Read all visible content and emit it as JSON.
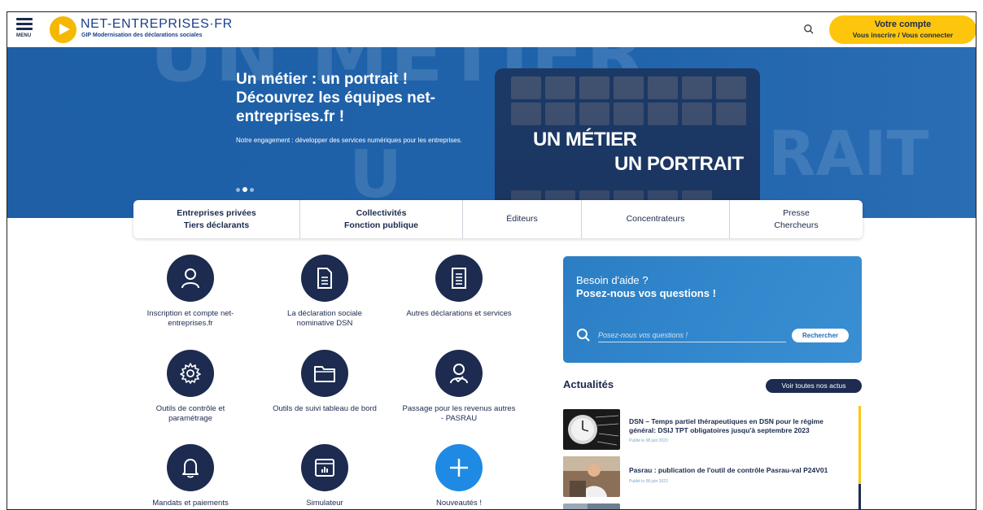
{
  "header": {
    "menu_label": "MENU",
    "logo_title": "NET-ENTREPRISES·FR",
    "logo_subtitle": "GIP Modernisation des déclarations sociales",
    "account_line1": "Votre compte",
    "account_line2": "Vous inscrire / Vous connecter"
  },
  "hero": {
    "bg_word_1": "UN MÉTIER",
    "bg_word_2": "RAIT",
    "bg_word_3": "U",
    "title": "Un métier : un portrait ! Découvrez les équipes net-entreprises.fr !",
    "text": "Notre engagement : développer des services numériques pour les entreprises.",
    "photo_line1": "UN MÉTIER",
    "photo_line2": "UN PORTRAIT",
    "slide_count": 3,
    "active_slide": 2
  },
  "tabs": [
    {
      "line1": "Entreprises privées",
      "line2": "Tiers déclarants"
    },
    {
      "line1": "Collectivités",
      "line2": "Fonction publique"
    },
    {
      "line1": "Éditeurs",
      "line2": ""
    },
    {
      "line1": "Concentrateurs",
      "line2": ""
    },
    {
      "line1": "Presse",
      "line2": "Chercheurs"
    }
  ],
  "services": [
    {
      "label": "Inscription et compte net-entreprises.fr",
      "icon": "user-icon"
    },
    {
      "label": "La déclaration sociale nominative DSN",
      "icon": "document-icon"
    },
    {
      "label": "Autres déclarations et services",
      "icon": "document-list-icon"
    },
    {
      "label": "Outils de contrôle et paramétrage",
      "icon": "gear-icon"
    },
    {
      "label": "Outils de suivi tableau de bord",
      "icon": "folder-icon"
    },
    {
      "label": "Passage pour les revenus autres - PASRAU",
      "icon": "user-check-icon"
    },
    {
      "label": "Mandats et paiements",
      "icon": "bell-icon"
    },
    {
      "label": "Simulateur",
      "icon": "chart-window-icon"
    },
    {
      "label": "Nouveautés !",
      "icon": "plus-icon"
    }
  ],
  "help": {
    "line1": "Besoin d'aide ?",
    "line2": "Posez-nous vos questions !",
    "placeholder": "Posez-nous vos questions !",
    "button": "Rechercher"
  },
  "news": {
    "title": "Actualités",
    "see_all": "Voir toutes nos actus",
    "items": [
      {
        "title": "DSN – Temps partiel thérapeutiques en DSN pour le régime général: DSIJ TPT obligatoires jusqu'à septembre 2023",
        "date": "Publié le 08 juin 2023"
      },
      {
        "title": "Pasrau : publication de l'outil de contrôle Pasrau-val P24V01",
        "date": "Publié le 08 juin 2023"
      }
    ]
  }
}
